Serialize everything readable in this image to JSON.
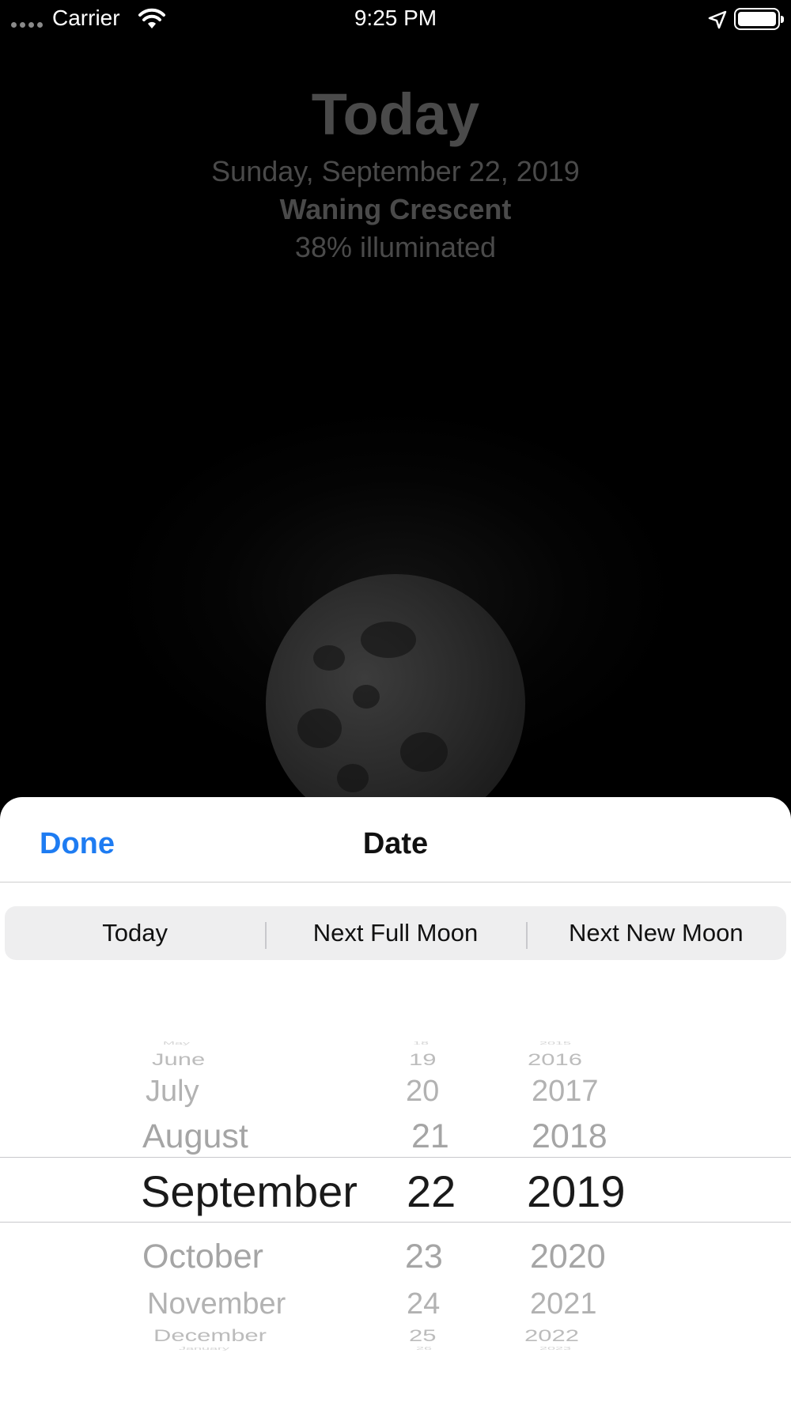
{
  "status_bar": {
    "carrier": "Carrier",
    "time": "9:25 PM"
  },
  "moon_info": {
    "title": "Today",
    "date": "Sunday, September 22, 2019",
    "phase": "Waning Crescent",
    "illumination": "38% illuminated"
  },
  "sheet": {
    "done_label": "Done",
    "title": "Date",
    "segments": [
      "Today",
      "Next Full Moon",
      "Next New Moon"
    ]
  },
  "picker": {
    "months": {
      "above": [
        "May",
        "June",
        "July",
        "August"
      ],
      "selected": "September",
      "below": [
        "October",
        "November",
        "December",
        "January"
      ]
    },
    "days": {
      "above": [
        "18",
        "19",
        "20",
        "21"
      ],
      "selected": "22",
      "below": [
        "23",
        "24",
        "25",
        "26"
      ]
    },
    "years": {
      "above": [
        "2015",
        "2016",
        "2017",
        "2018"
      ],
      "selected": "2019",
      "below": [
        "2020",
        "2021",
        "2022",
        "2023"
      ]
    }
  },
  "colors": {
    "accent": "#1e7cf2",
    "background": "#000000",
    "sheet": "#ffffff"
  }
}
